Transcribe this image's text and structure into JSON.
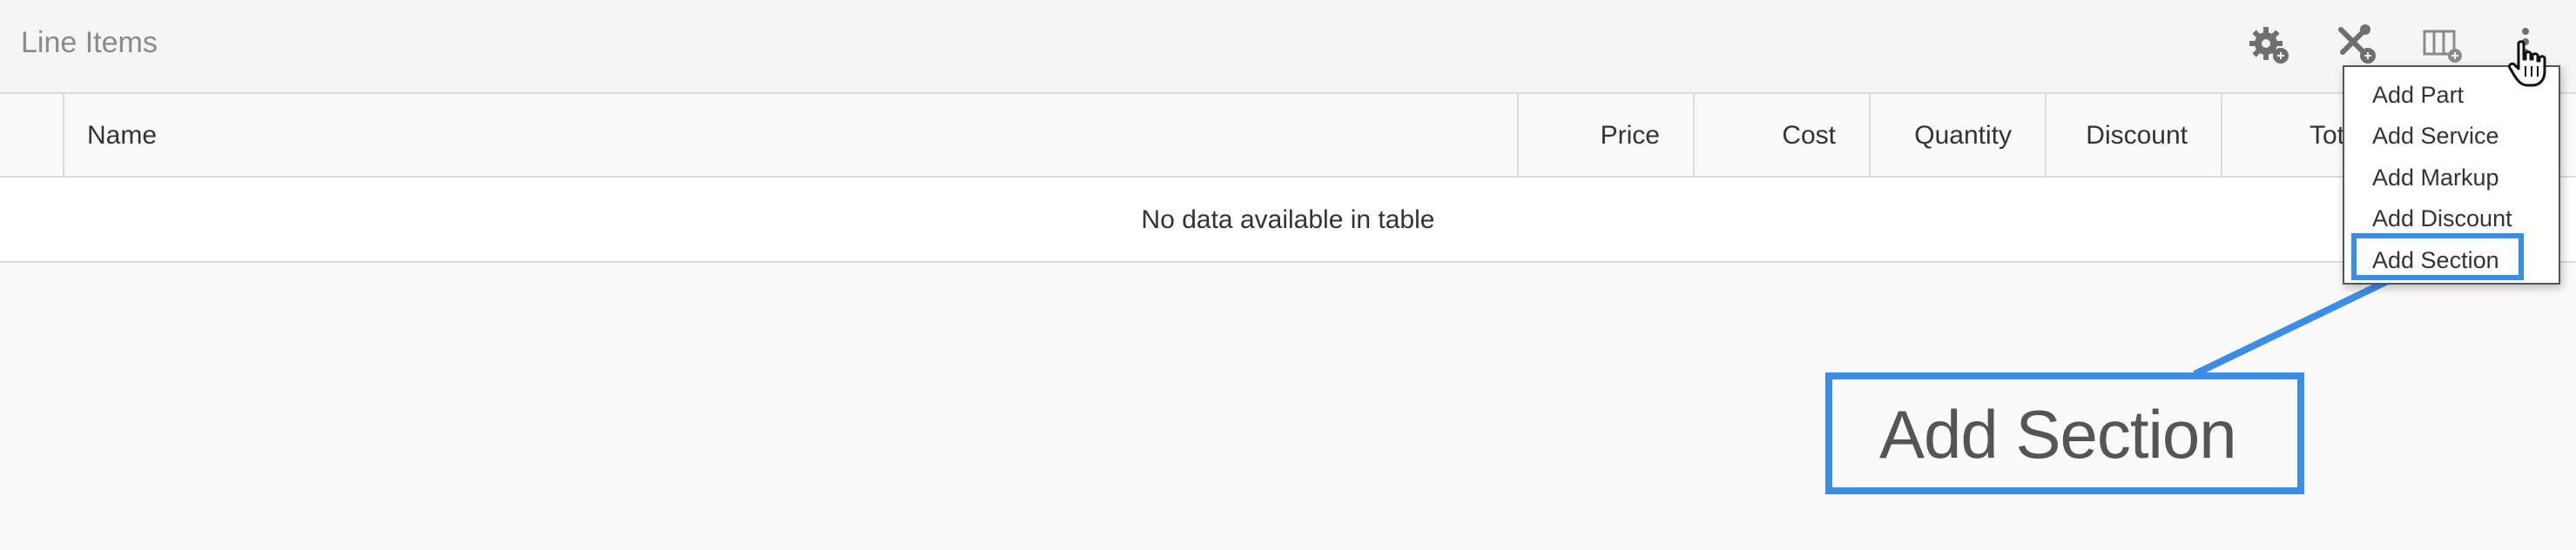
{
  "header": {
    "title": "Line Items",
    "icons": [
      "settings-add-icon",
      "tools-add-icon",
      "columns-add-icon",
      "more-vertical-icon"
    ]
  },
  "table": {
    "columns": [
      "",
      "Name",
      "Price",
      "Cost",
      "Quantity",
      "Discount",
      "Total"
    ],
    "empty_message": "No data available in table"
  },
  "menu": {
    "items": [
      "Add Part",
      "Add Service",
      "Add Markup",
      "Add Discount",
      "Add Section"
    ],
    "highlighted": "Add Section"
  },
  "callout": {
    "text": "Add Section",
    "color": "#3b8ee6"
  }
}
